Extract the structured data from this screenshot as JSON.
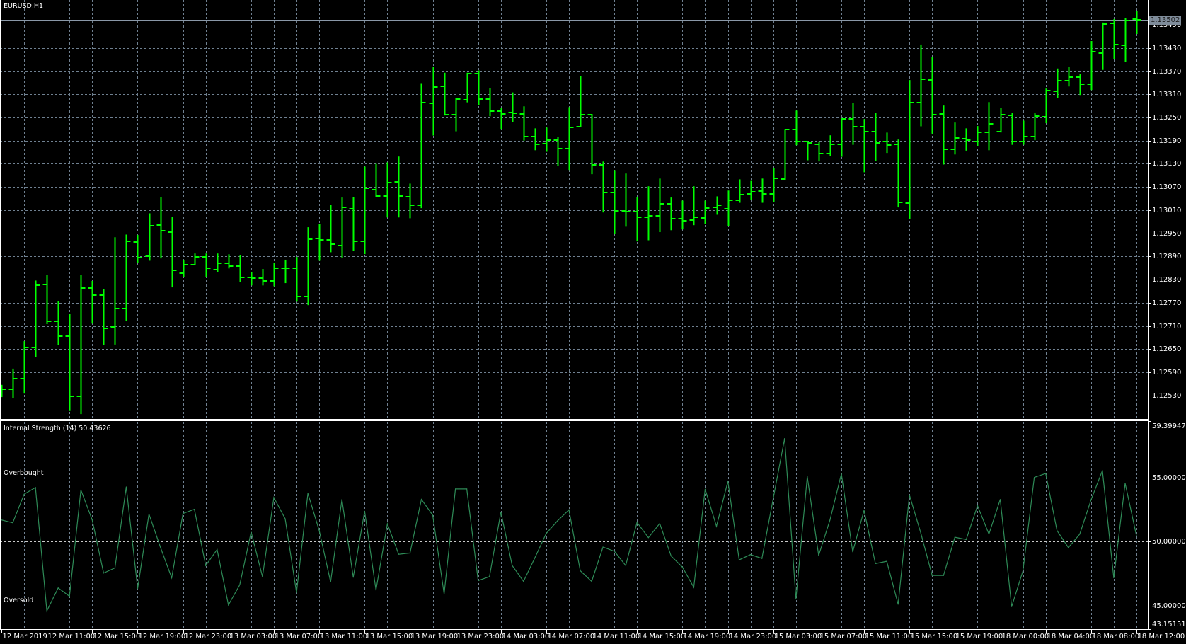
{
  "window": {
    "title": "EURUSD,H1"
  },
  "colors": {
    "background": "#000000",
    "bars": "#00ff00",
    "grid": "#6f8090",
    "indicator_line": "#2e8b57",
    "levels": "#c8c8c8",
    "axis": "#ffffff",
    "bid_line": "#8a98a8"
  },
  "chart_data": [
    {
      "type": "ohlc",
      "title": "EURUSD,H1",
      "timeframe": "H1",
      "x_labels": [
        "12 Mar 2019",
        "12 Mar 11:00",
        "12 Mar 15:00",
        "12 Mar 19:00",
        "12 Mar 23:00",
        "13 Mar 03:00",
        "13 Mar 07:00",
        "13 Mar 11:00",
        "13 Mar 15:00",
        "13 Mar 19:00",
        "13 Mar 23:00",
        "14 Mar 03:00",
        "14 Mar 07:00",
        "14 Mar 11:00",
        "14 Mar 15:00",
        "14 Mar 19:00",
        "14 Mar 23:00",
        "15 Mar 03:00",
        "15 Mar 07:00",
        "15 Mar 11:00",
        "15 Mar 15:00",
        "15 Mar 19:00",
        "18 Mar 00:00",
        "18 Mar 04:00",
        "18 Mar 08:00",
        "18 Mar 12:00"
      ],
      "x_label_every_bars": 4,
      "y_ticks": [
        "1.13490",
        "1.13430",
        "1.13370",
        "1.13310",
        "1.13250",
        "1.13190",
        "1.13130",
        "1.13070",
        "1.13010",
        "1.12950",
        "1.12890",
        "1.12830",
        "1.12770",
        "1.12710",
        "1.12650",
        "1.12590",
        "1.12530"
      ],
      "current_price": "1.13502",
      "grid": true,
      "ohlc": [
        [
          1.12546,
          1.12556,
          1.12528,
          1.12546
        ],
        [
          1.12546,
          1.12598,
          1.12526,
          1.12574
        ],
        [
          1.12574,
          1.12669,
          1.12537,
          1.12654
        ],
        [
          1.12654,
          1.12826,
          1.12632,
          1.12815
        ],
        [
          1.12817,
          1.12841,
          1.12717,
          1.12722
        ],
        [
          1.12722,
          1.12772,
          1.12662,
          1.12684
        ],
        [
          1.12684,
          1.1274,
          1.12492,
          1.12528
        ],
        [
          1.12528,
          1.12841,
          1.12484,
          1.12808
        ],
        [
          1.12808,
          1.12825,
          1.12718,
          1.1279
        ],
        [
          1.1279,
          1.12803,
          1.12662,
          1.12704
        ],
        [
          1.12708,
          1.12938,
          1.12664,
          1.12755
        ],
        [
          1.12755,
          1.12945,
          1.12726,
          1.12929
        ],
        [
          1.12927,
          1.12944,
          1.12876,
          1.12887
        ],
        [
          1.12891,
          1.13,
          1.12881,
          1.12969
        ],
        [
          1.12971,
          1.13042,
          1.12887,
          1.12956
        ],
        [
          1.12953,
          1.12991,
          1.12812,
          1.12854
        ],
        [
          1.12847,
          1.1288,
          1.12839,
          1.12869
        ],
        [
          1.12869,
          1.12896,
          1.12869,
          1.12889
        ],
        [
          1.12889,
          1.12896,
          1.12839,
          1.12859
        ],
        [
          1.12856,
          1.12896,
          1.12852,
          1.12872
        ],
        [
          1.12872,
          1.12894,
          1.12861,
          1.12865
        ],
        [
          1.12865,
          1.12891,
          1.12825,
          1.12836
        ],
        [
          1.12836,
          1.12848,
          1.12817,
          1.12834
        ],
        [
          1.12834,
          1.12856,
          1.12817,
          1.12826
        ],
        [
          1.12826,
          1.12872,
          1.12815,
          1.12859
        ],
        [
          1.12859,
          1.1288,
          1.12823,
          1.12859
        ],
        [
          1.12859,
          1.12887,
          1.12775,
          1.12786
        ],
        [
          1.12786,
          1.12964,
          1.12766,
          1.12934
        ],
        [
          1.12936,
          1.12973,
          1.12881,
          1.12933
        ],
        [
          1.12933,
          1.13022,
          1.12903,
          1.12922
        ],
        [
          1.12918,
          1.13041,
          1.12889,
          1.13017
        ],
        [
          1.13013,
          1.13042,
          1.12907,
          1.12929
        ],
        [
          1.12929,
          1.13121,
          1.12898,
          1.13066
        ],
        [
          1.13064,
          1.13128,
          1.13046,
          1.13046
        ],
        [
          1.13046,
          1.13132,
          1.12993,
          1.13081
        ],
        [
          1.13083,
          1.13147,
          1.12993,
          1.13046
        ],
        [
          1.13044,
          1.13077,
          1.12991,
          1.13022
        ],
        [
          1.13022,
          1.13337,
          1.13017,
          1.13288
        ],
        [
          1.13286,
          1.13379,
          1.13205,
          1.13328
        ],
        [
          1.1333,
          1.13364,
          1.13257,
          1.13257
        ],
        [
          1.13257,
          1.13299,
          1.13216,
          1.13297
        ],
        [
          1.13295,
          1.13364,
          1.13291,
          1.13364
        ],
        [
          1.13364,
          1.1337,
          1.13284,
          1.13297
        ],
        [
          1.13297,
          1.13324,
          1.13255,
          1.13266
        ],
        [
          1.13266,
          1.13273,
          1.13222,
          1.1326
        ],
        [
          1.13262,
          1.13313,
          1.1324,
          1.13261
        ],
        [
          1.1326,
          1.13277,
          1.13192,
          1.132
        ],
        [
          1.132,
          1.1322,
          1.13167,
          1.13181
        ],
        [
          1.13183,
          1.13222,
          1.13163,
          1.13191
        ],
        [
          1.13191,
          1.13198,
          1.13127,
          1.13169
        ],
        [
          1.13169,
          1.13275,
          1.13116,
          1.13225
        ],
        [
          1.13227,
          1.13355,
          1.13227,
          1.13257
        ],
        [
          1.13257,
          1.13257,
          1.13105,
          1.13127
        ],
        [
          1.13127,
          1.13134,
          1.13006,
          1.13055
        ],
        [
          1.13055,
          1.13112,
          1.12951,
          1.13009
        ],
        [
          1.13008,
          1.13103,
          1.12969,
          1.13006
        ],
        [
          1.13006,
          1.13042,
          1.12931,
          1.12991
        ],
        [
          1.12991,
          1.1307,
          1.12934,
          1.12995
        ],
        [
          1.12995,
          1.1309,
          1.12955,
          1.13026
        ],
        [
          1.13026,
          1.13041,
          1.1296,
          1.12988
        ],
        [
          1.12988,
          1.13033,
          1.12962,
          1.12982
        ],
        [
          1.12984,
          1.1307,
          1.12973,
          1.12991
        ],
        [
          1.12989,
          1.13033,
          1.12977,
          1.13015
        ],
        [
          1.13017,
          1.13044,
          1.13,
          1.13022
        ],
        [
          1.13013,
          1.13059,
          1.12971,
          1.13035
        ],
        [
          1.13035,
          1.13088,
          1.13031,
          1.1305
        ],
        [
          1.13052,
          1.13084,
          1.13039,
          1.13057
        ],
        [
          1.13059,
          1.1309,
          1.13031,
          1.13052
        ],
        [
          1.13052,
          1.13117,
          1.13033,
          1.13092
        ],
        [
          1.1309,
          1.13218,
          1.1309,
          1.13218
        ],
        [
          1.13218,
          1.13266,
          1.1318,
          1.13187
        ],
        [
          1.13187,
          1.13187,
          1.13141,
          1.13184
        ],
        [
          1.1318,
          1.13186,
          1.13138,
          1.13156
        ],
        [
          1.13156,
          1.13202,
          1.13152,
          1.13181
        ],
        [
          1.1318,
          1.13246,
          1.1315,
          1.13246
        ],
        [
          1.13246,
          1.13286,
          1.13181,
          1.13227
        ],
        [
          1.13227,
          1.13244,
          1.1311,
          1.13213
        ],
        [
          1.13213,
          1.1326,
          1.13139,
          1.13184
        ],
        [
          1.13187,
          1.13209,
          1.1316,
          1.13178
        ],
        [
          1.1318,
          1.13191,
          1.13019,
          1.1303
        ],
        [
          1.13028,
          1.13345,
          1.12989,
          1.13288
        ],
        [
          1.13288,
          1.13437,
          1.13229,
          1.13349
        ],
        [
          1.13347,
          1.13405,
          1.1321,
          1.13257
        ],
        [
          1.13259,
          1.13279,
          1.1313,
          1.13167
        ],
        [
          1.13167,
          1.13235,
          1.13156,
          1.13197
        ],
        [
          1.13195,
          1.1322,
          1.13166,
          1.13191
        ],
        [
          1.13187,
          1.13226,
          1.13178,
          1.13211
        ],
        [
          1.13211,
          1.13288,
          1.13167,
          1.13233
        ],
        [
          1.13213,
          1.13273,
          1.13213,
          1.13257
        ],
        [
          1.13255,
          1.1326,
          1.13181,
          1.13187
        ],
        [
          1.13187,
          1.1324,
          1.13181,
          1.132
        ],
        [
          1.132,
          1.13259,
          1.13193,
          1.13253
        ],
        [
          1.13251,
          1.13323,
          1.13237,
          1.13319
        ],
        [
          1.13317,
          1.13375,
          1.13303,
          1.13346
        ],
        [
          1.13346,
          1.13379,
          1.13332,
          1.13355
        ],
        [
          1.13354,
          1.1336,
          1.1331,
          1.13337
        ],
        [
          1.13337,
          1.13446,
          1.13323,
          1.1342
        ],
        [
          1.13417,
          1.13494,
          1.13375,
          1.13492
        ],
        [
          1.13494,
          1.13503,
          1.13402,
          1.13439
        ],
        [
          1.13437,
          1.13505,
          1.13395,
          1.13501
        ],
        [
          1.13505,
          1.13523,
          1.13468,
          1.13502
        ]
      ]
    },
    {
      "type": "line",
      "title": "Internal Strength (14) 50.43626",
      "ylim": [
        43.15151,
        59.39947
      ],
      "y_ticks": [
        "59.39947",
        "55.00000",
        "50.00000",
        "45.00000",
        "43.15151"
      ],
      "y_tick_values": [
        59.39947,
        55,
        50,
        45,
        43.15151
      ],
      "levels": [
        {
          "value": 55,
          "label": "Overbought"
        },
        {
          "value": 50,
          "label": ""
        },
        {
          "value": 45,
          "label": "Oversold"
        }
      ],
      "values": [
        51.68,
        51.46,
        53.69,
        54.21,
        44.58,
        46.37,
        45.72,
        54.02,
        51.68,
        47.53,
        47.93,
        54.26,
        46.33,
        52.14,
        49.56,
        47.16,
        52.18,
        52.51,
        48.12,
        49.37,
        45.04,
        46.61,
        50.74,
        47.25,
        53.43,
        51.77,
        46.01,
        53.75,
        50.85,
        46.83,
        53.28,
        47.2,
        52.36,
        46.2,
        51.37,
        49.0,
        49.1,
        53.28,
        52.05,
        45.9,
        54.1,
        54.1,
        46.94,
        47.25,
        52.29,
        48.12,
        46.88,
        48.73,
        50.63,
        51.62,
        52.47,
        47.71,
        46.88,
        49.56,
        49.23,
        48.12,
        51.49,
        50.3,
        51.4,
        48.86,
        47.99,
        46.42,
        54.08,
        51.18,
        54.69,
        48.56,
        48.97,
        48.67,
        53.36,
        58.04,
        45.5,
        55.06,
        48.91,
        51.68,
        55.28,
        49.19,
        52.42,
        48.27,
        48.45,
        45.09,
        53.62,
        50.66,
        47.34,
        47.34,
        50.33,
        50.15,
        52.79,
        50.57,
        53.28,
        44.91,
        47.71,
        55.0,
        55.31,
        50.85,
        49.52,
        50.57,
        53.25,
        55.54,
        47.16,
        54.54,
        50.44
      ]
    }
  ]
}
